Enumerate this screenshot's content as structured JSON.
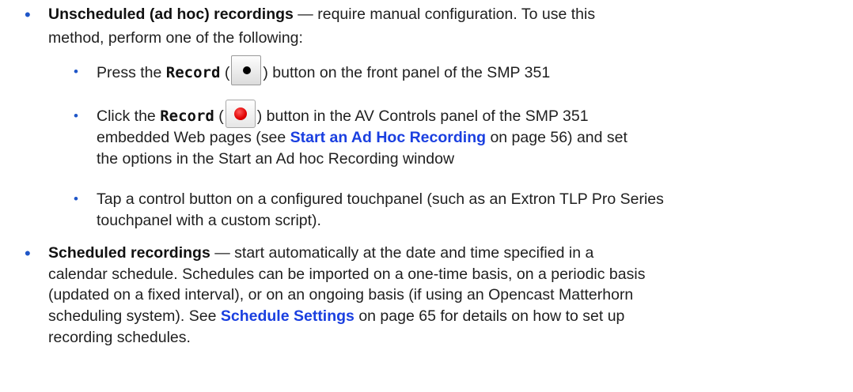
{
  "bullet_char": "•",
  "items": {
    "unscheduled": {
      "term": "Unscheduled (ad hoc) recordings",
      "line1_rest": " — require manual configuration. To use this",
      "line2": "method, perform one of the following:",
      "sub": {
        "press": {
          "pre": "Press the ",
          "button_name": "Record",
          "open_paren": " (",
          "close_paren": ") button on the front panel of the SMP 351",
          "icon": "record-dot-icon"
        },
        "click": {
          "pre": "Click the ",
          "button_name": "Record",
          "open_paren": " (",
          "post": ") button in the AV Controls panel of the SMP 351",
          "line2_pre": "embedded Web pages (see ",
          "link": "Start an Ad Hoc Recording",
          "line2_post": " on page 56) and set",
          "line3": "the options in the Start an Ad hoc Recording window",
          "icon": "red-record-icon",
          "icon_color": "#e00000"
        },
        "tap": {
          "line1": "Tap a control button on a configured touchpanel (such as an Extron TLP Pro Series",
          "line2": "touchpanel with a custom script)."
        }
      }
    },
    "scheduled": {
      "term": "Scheduled recordings",
      "line1_rest": " — start automatically at the date and time specified in a",
      "line2": "calendar schedule. Schedules can be imported on a one-time basis, on a periodic basis",
      "line3": "(updated on a fixed interval), or on an ongoing basis (if using an Opencast Matterhorn",
      "line4_pre": "scheduling system). See ",
      "link": "Schedule Settings",
      "line4_post": " on page 65 for details on how to set up",
      "line5": "recording schedules."
    }
  },
  "colors": {
    "bullet": "#1f56c8",
    "link": "#1a3fe0"
  }
}
